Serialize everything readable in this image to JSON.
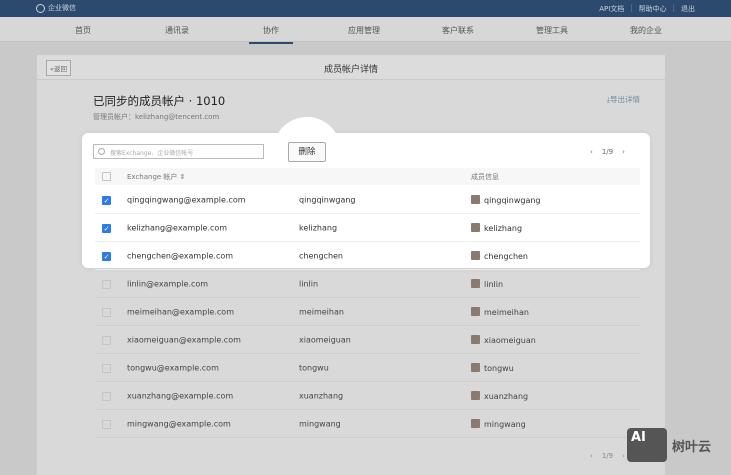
{
  "topbar": {
    "logo": "企业微信",
    "links": [
      "API文档",
      "帮助中心",
      "退出"
    ]
  },
  "nav": {
    "items": [
      "首页",
      "通讯录",
      "协作",
      "应用管理",
      "客户联系",
      "管理工具",
      "我的企业"
    ],
    "active": "协作"
  },
  "panel": {
    "back": "«返回",
    "title": "成员帐户详情",
    "heading": "已同步的成员帐户 · 1010",
    "admin": "管理员帐户：kelizhang@tencent.com",
    "export": "⤓导出详情"
  },
  "toolbar": {
    "search_placeholder": "搜索Exchange、企业微信帐号",
    "delete": "删除",
    "page": "1/9"
  },
  "table": {
    "headers": [
      "Exchange 帐户 ⇕",
      "",
      "成员信息"
    ],
    "rows": [
      {
        "email": "qingqingwang@example.com",
        "account": "qingqinwgang",
        "member": "qingqinwgang",
        "checked": true
      },
      {
        "email": "kelizhang@example.com",
        "account": "kelizhang",
        "member": "kelizhang",
        "checked": true
      },
      {
        "email": "chengchen@example.com",
        "account": "chengchen",
        "member": "chengchen",
        "checked": true
      },
      {
        "email": "linlin@example.com",
        "account": "linlin",
        "member": "linlin",
        "checked": false
      },
      {
        "email": "meimeihan@example.com",
        "account": "meimeihan",
        "member": "meimeihan",
        "checked": false
      },
      {
        "email": "xiaomeiguan@example.com",
        "account": "xiaomeiguan",
        "member": "xiaomeiguan",
        "checked": false
      },
      {
        "email": "tongwu@example.com",
        "account": "tongwu",
        "member": "tongwu",
        "checked": false
      },
      {
        "email": "xuanzhang@example.com",
        "account": "xuanzhang",
        "member": "xuanzhang",
        "checked": false
      },
      {
        "email": "mingwang@example.com",
        "account": "mingwang",
        "member": "mingwang",
        "checked": false
      }
    ]
  },
  "footer": {
    "page": "1/9"
  },
  "watermark": {
    "logo": "AI",
    "text": "树叶云"
  },
  "colors": {
    "topbar": "#2c4a6e",
    "checkbox": "#2d7be5",
    "link": "#6f86a4"
  }
}
